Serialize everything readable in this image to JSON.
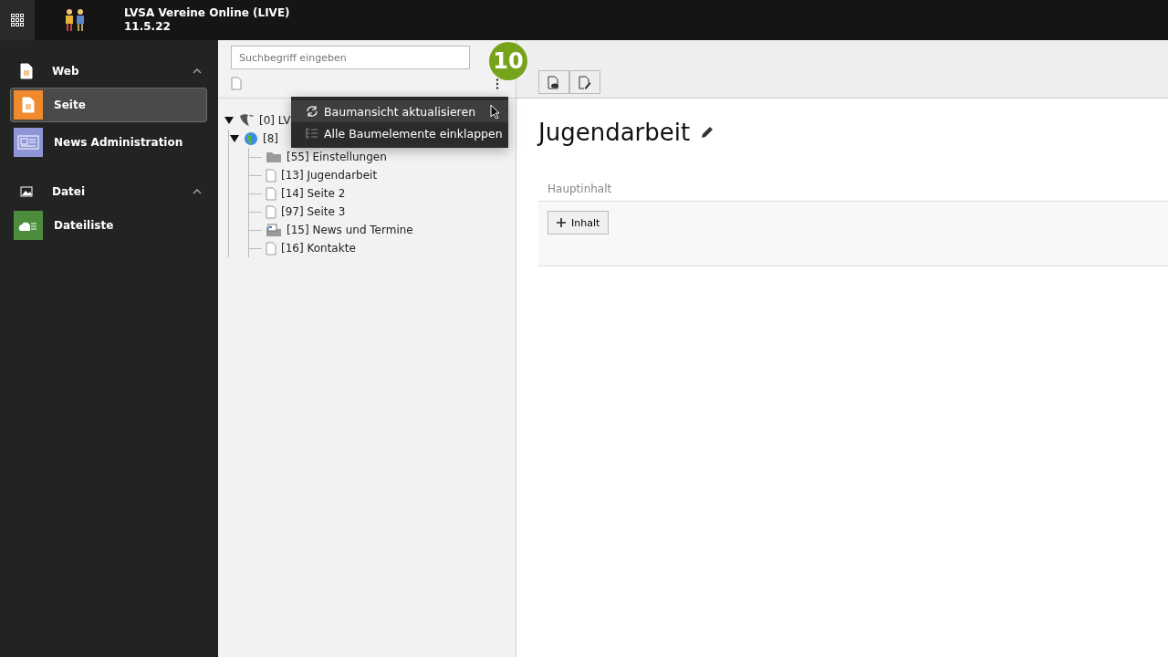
{
  "topbar": {
    "title": "LVSA Vereine Online (LIVE)",
    "version": "11.5.22"
  },
  "modules": [
    {
      "label": "Web",
      "expanded": true,
      "kind": "page",
      "items": [
        {
          "label": "Seite",
          "selected": true,
          "kind": "page"
        },
        {
          "label": "News Administration",
          "selected": false,
          "kind": "news"
        }
      ]
    },
    {
      "label": "Datei",
      "expanded": true,
      "kind": "image",
      "items": [
        {
          "label": "Dateiliste",
          "selected": false,
          "kind": "files"
        }
      ]
    }
  ],
  "tree_panel": {
    "search": {
      "placeholder": "Suchbegriff eingeben"
    },
    "tree": [
      {
        "label": "[0] LV",
        "expanded": true,
        "kind": "root",
        "children": [
          {
            "label": "[8]",
            "expanded": true,
            "kind": "globe",
            "children": [
              {
                "label": "[55] Einstellungen",
                "kind": "folder"
              },
              {
                "label": "[13] Jugendarbeit",
                "kind": "page"
              },
              {
                "label": "[14] Seite 2",
                "kind": "page"
              },
              {
                "label": "[97] Seite 3",
                "kind": "page"
              },
              {
                "label": "[15] News und Termine",
                "kind": "newsfolder"
              },
              {
                "label": "[16] Kontakte",
                "kind": "page"
              }
            ]
          }
        ]
      }
    ],
    "menu": [
      {
        "label": "Baumansicht aktualisieren",
        "selected": true,
        "kind": "refresh"
      },
      {
        "label": "Alle Baumelemente einklappen",
        "selected": false,
        "kind": "collapse"
      }
    ]
  },
  "step_badge": "10",
  "content": {
    "title": "Jugendarbeit",
    "column": {
      "header": "Hauptinhalt",
      "button": "Inhalt"
    }
  }
}
